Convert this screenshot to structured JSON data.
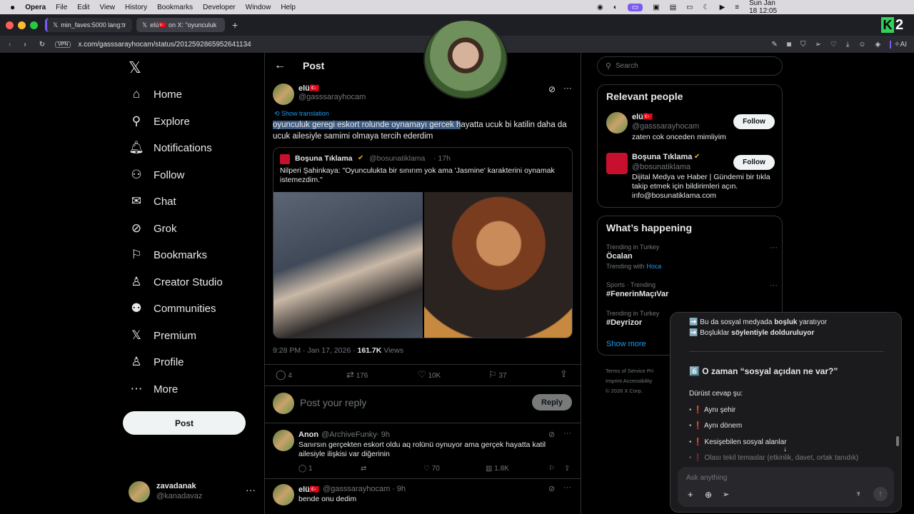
{
  "menubar": {
    "app": "Opera",
    "items": [
      "File",
      "Edit",
      "View",
      "History",
      "Bookmarks",
      "Developer",
      "Window",
      "Help"
    ],
    "clock": "Sun Jan 18  12:05"
  },
  "tabs": [
    {
      "label": "min_faves:5000 lang:tr"
    },
    {
      "label": "elü🇹🇷 on X: \"oyunculuk"
    }
  ],
  "address": {
    "vpn": "VPN",
    "url": "x.com/gasssarayhocam/status/2012592865952641134",
    "ai": "AI"
  },
  "nav": {
    "items": [
      "Home",
      "Explore",
      "Notifications",
      "Follow",
      "Chat",
      "Grok",
      "Bookmarks",
      "Creator Studio",
      "Communities",
      "Premium",
      "Profile",
      "More"
    ],
    "post": "Post",
    "account_name": "zavadanak",
    "account_handle": "@kanadavaz"
  },
  "post": {
    "header": "Post",
    "author": "elü🇹🇷",
    "handle": "@gasssarayhocam",
    "show_translation": "Show translation",
    "text_highlight": "oyunculuk geregi eskort rolunde oynamayı gercek h",
    "text_rest": "ayatta ucuk bi katilin daha da ucuk ailesiyle samimi olmaya tercih ederdim",
    "quote": {
      "author": "Boşuna Tıklama",
      "handle": "@bosunatiklama",
      "time": "· 17h",
      "text": "Nilperi Şahinkaya: \"Oyunculukta bir sınırım yok ama 'Jasmine' karakterini oynamak istemezdim.\""
    },
    "meta_time": "9:28 PM · Jan 17, 2026 · ",
    "views_count": "161.7K",
    "views_label": " Views",
    "stats": {
      "replies": "4",
      "reposts": "176",
      "likes": "10K",
      "bookmarks": "37"
    },
    "reply_placeholder": "Post your reply",
    "reply_button": "Reply"
  },
  "replies": [
    {
      "author": "Anon",
      "handle": "@ArchiveFunky",
      "time": "· 9h",
      "text": "Sanırsın gerçekten eskort oldu aq rolünü oynuyor ama gerçek hayatta katil ailesiyle ilişkisi var diğerinin",
      "replies": "1",
      "likes": "70",
      "views": "1.8K"
    },
    {
      "author": "elü🇹🇷",
      "handle": "@gasssarayhocam",
      "time": "· 9h",
      "text": "bende onu dedim"
    }
  ],
  "sidebar": {
    "search_placeholder": "Search",
    "relevant_title": "Relevant people",
    "people": [
      {
        "name": "elü🇹🇷",
        "handle": "@gasssarayhocam",
        "bio": "zaten cok onceden mimliyim",
        "button": "Follow"
      },
      {
        "name": "Boşuna Tıklama",
        "handle": "@bosunatiklama",
        "bio": "Dijital Medya ve Haber | Gündemi bir tıkla takip etmek için bildirimleri açın. info@bosunatiklama.com",
        "button": "Follow"
      }
    ],
    "happening_title": "What’s happening",
    "trends": [
      {
        "context": "Trending in Turkey",
        "name": "Öcalan",
        "with_label": "Trending with",
        "with": "Hoca"
      },
      {
        "context": "Sports · Trending",
        "name": "#FenerinMaçıVar"
      },
      {
        "context": "Trending in Turkey",
        "name": "#Deyrizor"
      }
    ],
    "show_more": "Show more",
    "footer1": "Terms of Service   Pri",
    "footer2": "Imprint   Accessibility",
    "footer3": "© 2026 X Corp."
  },
  "ai": {
    "line1_a": "➡️ Bu da sosyal medyada ",
    "line1_b": "boşluk",
    "line1_c": " yaratıyor",
    "line2_a": "➡️ Boşluklar ",
    "line2_b": "söylentiyle dolduruluyor",
    "heading": "6️⃣ O zaman “sosyal açıdan ne var?”",
    "intro": "Dürüst cevap şu:",
    "bullets": [
      "Aynı şehir",
      "Aynı dönem",
      "Kesişebilen sosyal alanlar",
      "Olası tekil temaslar (etkinlik, davet, ortak tanıdık)"
    ],
    "input_placeholder": "Ask anything"
  },
  "colors": {
    "accent": "#1d9bf0",
    "ai_tab": "#7b5cf0",
    "opera_green": "#31d158"
  }
}
